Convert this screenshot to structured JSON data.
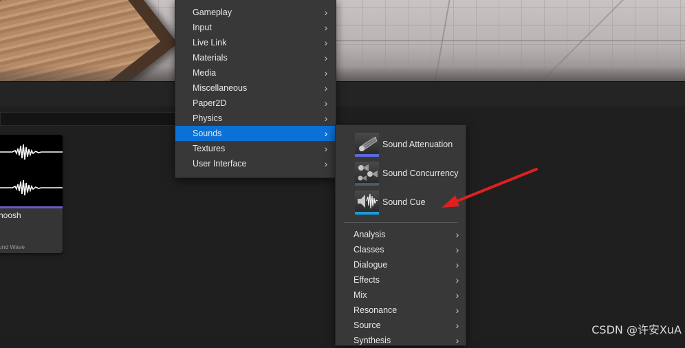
{
  "main_menu": {
    "items": [
      {
        "label": "Gameplay",
        "selected": false
      },
      {
        "label": "Input",
        "selected": false
      },
      {
        "label": "Live Link",
        "selected": false
      },
      {
        "label": "Materials",
        "selected": false
      },
      {
        "label": "Media",
        "selected": false
      },
      {
        "label": "Miscellaneous",
        "selected": false
      },
      {
        "label": "Paper2D",
        "selected": false
      },
      {
        "label": "Physics",
        "selected": false
      },
      {
        "label": "Sounds",
        "selected": true
      },
      {
        "label": "Textures",
        "selected": false
      },
      {
        "label": "User Interface",
        "selected": false
      }
    ],
    "chevron_icon": "chevron-right-icon",
    "selected_color": "#0b71d6"
  },
  "sounds_submenu": {
    "assets": [
      {
        "label": "Sound Attenuation",
        "icon": "sound-attenuation-icon",
        "accent": "#5a6ad8"
      },
      {
        "label": "Sound Concurrency",
        "icon": "sound-concurrency-icon",
        "accent": "#4a5870"
      },
      {
        "label": "Sound Cue",
        "icon": "sound-cue-icon",
        "accent": "#1a9ad8"
      }
    ],
    "categories": [
      {
        "label": "Analysis"
      },
      {
        "label": "Classes"
      },
      {
        "label": "Dialogue"
      },
      {
        "label": "Effects"
      },
      {
        "label": "Mix"
      },
      {
        "label": "Resonance"
      },
      {
        "label": "Source"
      },
      {
        "label": "Synthesis"
      }
    ]
  },
  "asset_tile": {
    "name": "hoosh",
    "type": "und Wave",
    "accent": "#6a5acd"
  },
  "annotation": {
    "arrow_color": "#e02020"
  },
  "watermark": "CSDN @许安XuA"
}
